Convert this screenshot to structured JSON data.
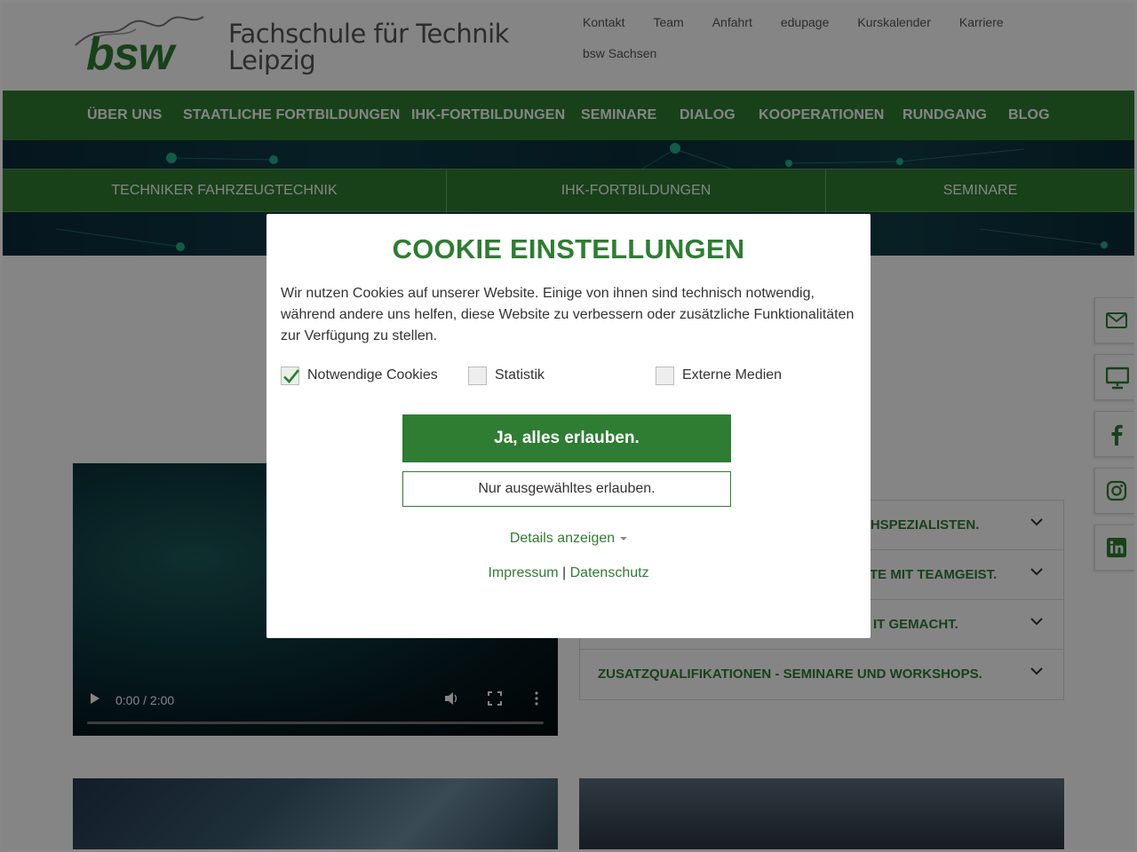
{
  "header": {
    "logo_text": "bsw",
    "school_line1": "Fachschule für Technik",
    "school_line2": "Leipzig",
    "top_links": [
      "Kontakt",
      "Team",
      "Anfahrt",
      "edupage",
      "Kurskalender",
      "Karriere",
      "bsw Sachsen"
    ]
  },
  "main_nav": [
    "ÜBER UNS",
    "STAATLICHE FORTBILDUNGEN",
    "IHK-FORTBILDUNGEN",
    "SEMINARE",
    "DIALOG",
    "KOOPERATIONEN",
    "RUNDGANG",
    "BLOG"
  ],
  "sub_nav": [
    "TECHNIKER FAHRZEUGTECHNIK",
    "IHK-FORTBILDUNGEN",
    "SEMINARE"
  ],
  "video": {
    "time": "0:00 / 2:00",
    "progress": 0
  },
  "accordion": [
    "CHSPEZIALISTEN.",
    "TE MIT TEAMGEIST.",
    "IT GEMACHT.",
    "ZUSATZQUALIFIKATIONEN - SEMINARE UND WORKSHOPS."
  ],
  "side_icons": [
    "mail-icon",
    "monitor-icon",
    "facebook-icon",
    "instagram-icon",
    "linkedin-icon"
  ],
  "cookie": {
    "title": "COOKIE EINSTELLUNGEN",
    "text": "Wir nutzen Cookies auf unserer Website. Einige von ihnen sind technisch notwendig, während andere uns helfen, diese Website zu verbessern oder zusätzliche Funktionalitäten zur Verfügung zu stellen.",
    "options": [
      {
        "label": "Notwendige Cookies",
        "checked": true
      },
      {
        "label": "Statistik",
        "checked": false
      },
      {
        "label": "Externe Medien",
        "checked": false
      }
    ],
    "accept_all": "Ja, alles erlauben.",
    "accept_selected": "Nur ausgewähltes erlauben.",
    "details": "Details anzeigen",
    "impressum": "Impressum",
    "separator": "|",
    "datenschutz": "Datenschutz"
  },
  "colors": {
    "brand_green": "#2e7d32",
    "overlay": "rgba(0,0,0,0.48)"
  }
}
